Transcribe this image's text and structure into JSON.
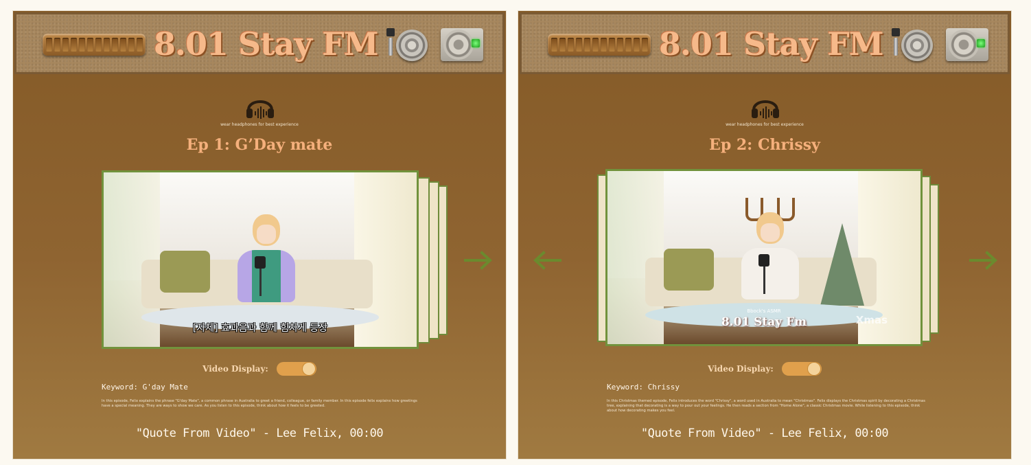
{
  "colors": {
    "panel_brown": "#8a6030",
    "title_peach": "#f6b98a",
    "toggle_orange": "#e0a04c",
    "arrow_green": "#6b8a2e",
    "frame_green": "#71923c"
  },
  "panels": [
    {
      "station_title": "8.01 Stay FM",
      "headphones_note": "wear headphones for best experience",
      "episode_title": "Ep 1: G’Day mate",
      "video": {
        "subtitle": "[자체] 효과음과 함께 힘차게 등장"
      },
      "video_display_label": "Video Display:",
      "video_display_on": true,
      "keyword": "Keyword: G'day Mate",
      "description": "In this episode, Felix explains the phrase \"G'day Mate\", a common phrase in Australia to greet a friend, colleague, or family member. In this episode felix explains how greetings have a special meaning. They are ways to show we care. As you listen to this episode, think about how it feels to be greeted.",
      "quote": "\"Quote From Video\" - Lee Felix, 00:00",
      "icons": {
        "tuner": "tuner-dial-icon",
        "speaker": "speaker-icon",
        "power": "power-button-icon",
        "headphones": "headphones-icon",
        "next": "arrow-right-icon"
      }
    },
    {
      "station_title": "8.01 Stay FM",
      "headphones_note": "wear headphones for best experience",
      "episode_title": "Ep 2: Chrissy",
      "video": {
        "overlay_small": "Bbock's ASMR",
        "overlay_logo": "8.01 Stay Fm",
        "overlay_xmas": "Xmas"
      },
      "video_display_label": "Video Display:",
      "video_display_on": true,
      "keyword": "Keyword: Chrissy",
      "description": "In this Christmas themed episode, Felix introduces the word \"Chrissy\", a word used in Australia to mean \"Christmas\". Felix displays the Christmas spirit by decorating a Christmas tree, explaining that decorating is a way to pour out your feelings. He then reads a section from \"Home Alone\", a classic Christmas movie. While listening to this episode, think about how decorating makes you feel.",
      "quote": "\"Quote From Video\" - Lee Felix, 00:00",
      "icons": {
        "tuner": "tuner-dial-icon",
        "speaker": "speaker-icon",
        "power": "power-button-icon",
        "headphones": "headphones-icon",
        "prev": "arrow-left-icon",
        "next": "arrow-right-icon"
      }
    }
  ]
}
